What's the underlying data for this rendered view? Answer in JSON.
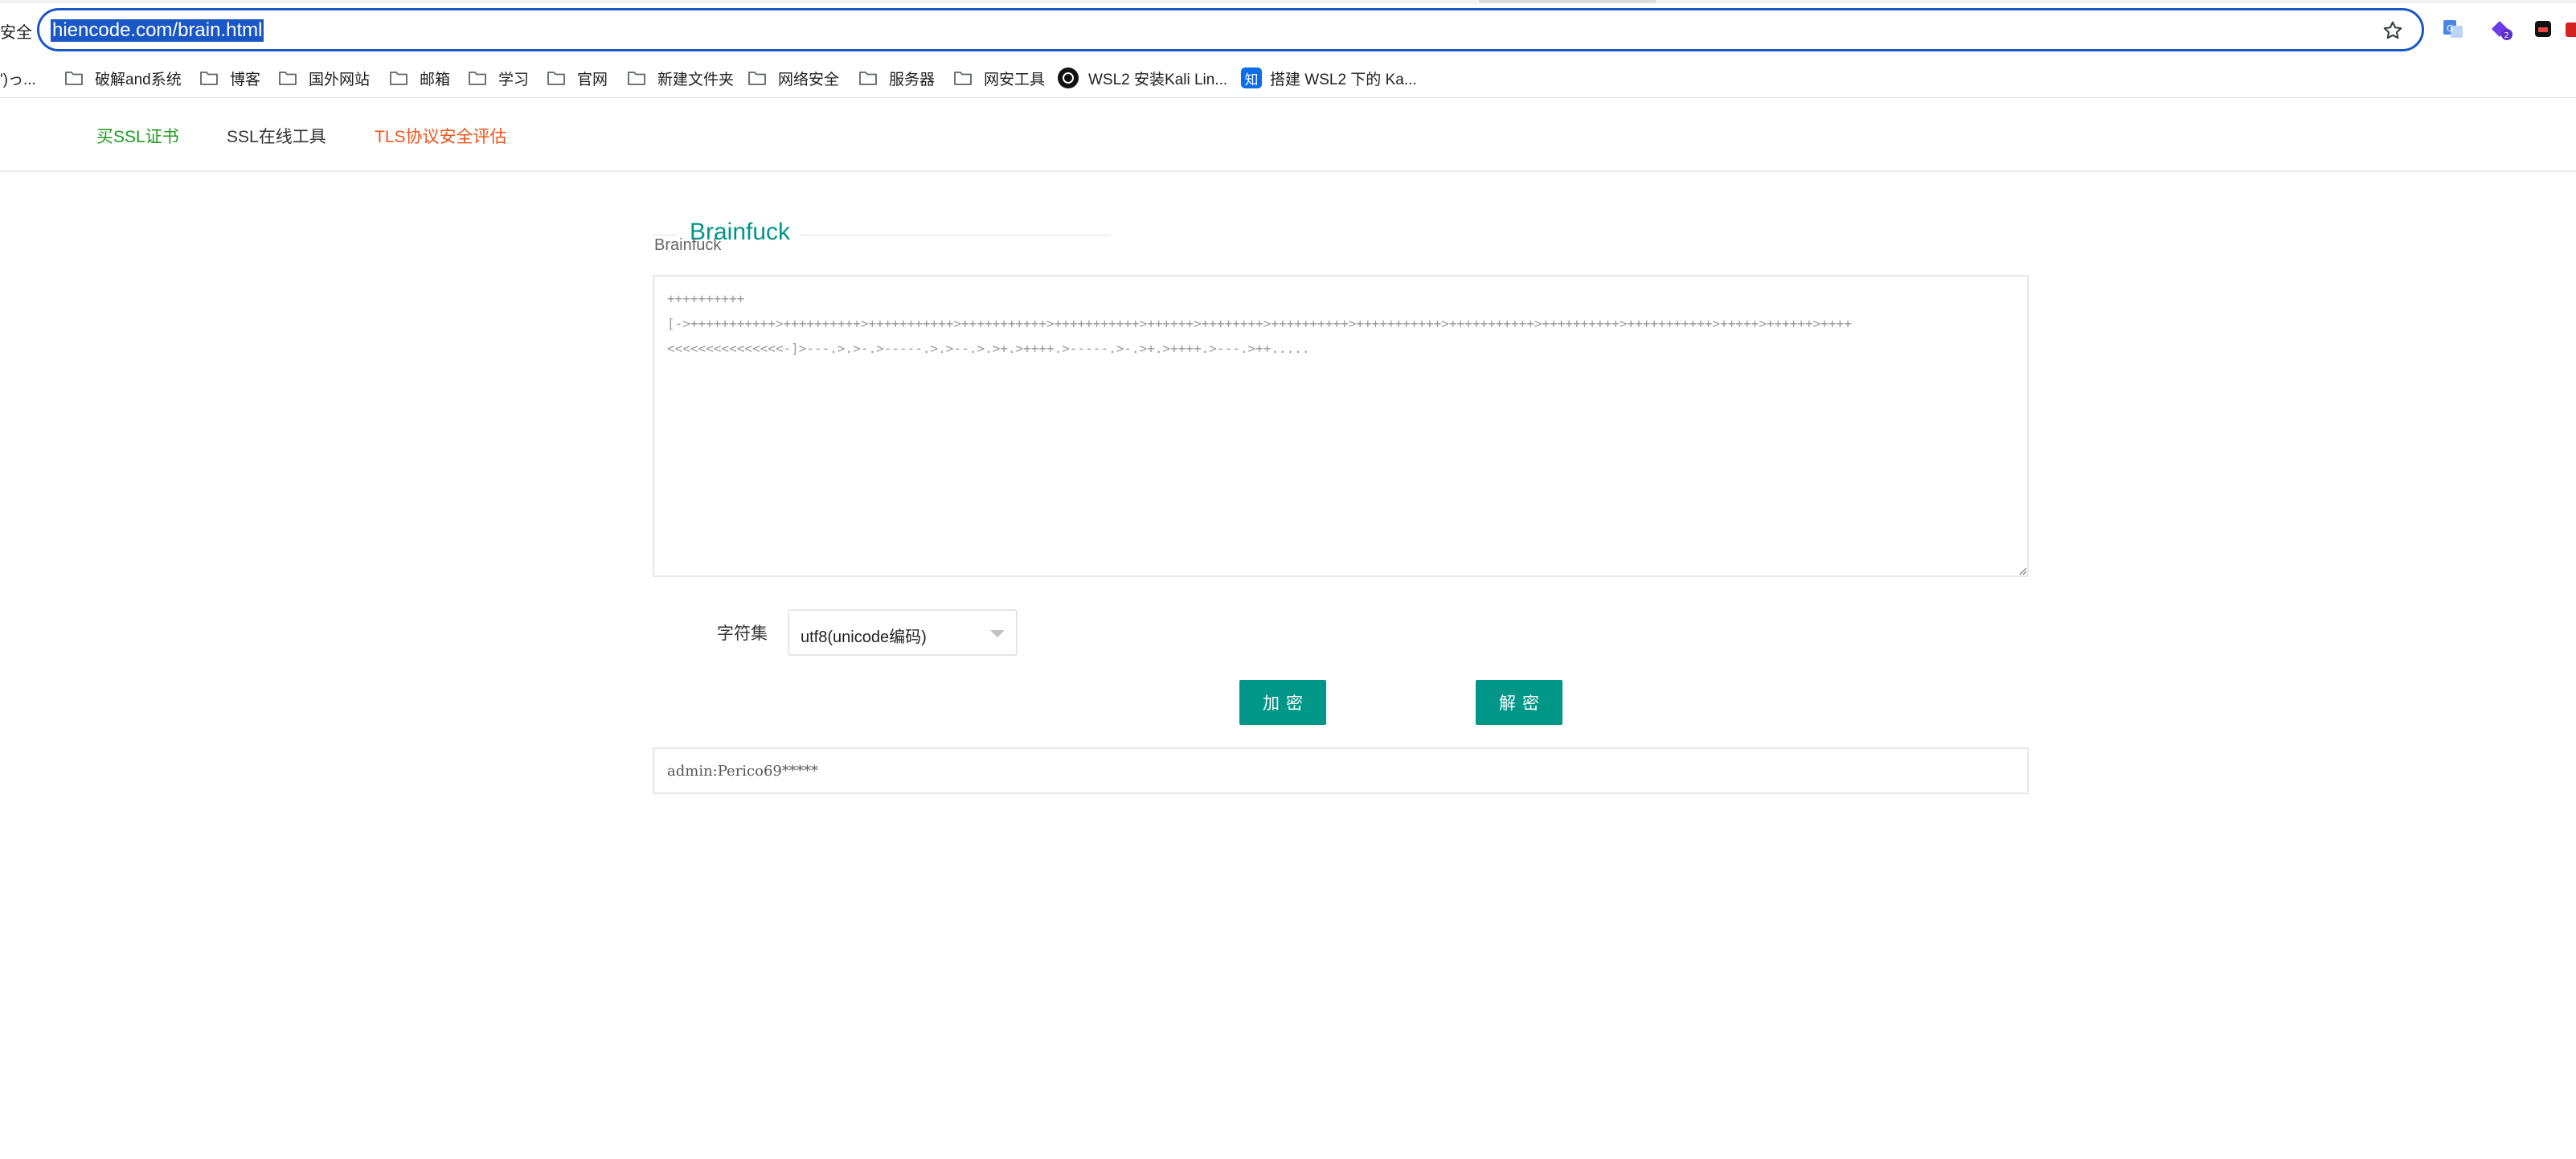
{
  "browser": {
    "security_label": "安全",
    "url": "hiencode.com/brain.html"
  },
  "bookmarks": [
    {
      "label": "')っ...",
      "icon": "none"
    },
    {
      "label": "破解and系统",
      "icon": "folder-icon"
    },
    {
      "label": "博客",
      "icon": "folder-icon"
    },
    {
      "label": "国外网站",
      "icon": "folder-icon"
    },
    {
      "label": "邮箱",
      "icon": "folder-icon"
    },
    {
      "label": "学习",
      "icon": "folder-icon"
    },
    {
      "label": "官网",
      "icon": "folder-icon"
    },
    {
      "label": "新建文件夹",
      "icon": "folder-icon"
    },
    {
      "label": "网络安全",
      "icon": "folder-icon"
    },
    {
      "label": "服务器",
      "icon": "folder-icon"
    },
    {
      "label": "网安工具",
      "icon": "folder-icon"
    },
    {
      "label": "WSL2 安装Kali Lin...",
      "icon": "site-icon"
    },
    {
      "label": "搭建 WSL2 下的 Ka...",
      "icon": "zhihu-icon",
      "icon_text": "知"
    }
  ],
  "nav": {
    "buy_ssl": "买SSL证书",
    "ssl_tools": "SSL在线工具",
    "tls_eval": "TLS协议安全评估"
  },
  "section": {
    "title": "Brainfuck",
    "field_label": "Brainfuck"
  },
  "code": "++++++++++\n[->+++++++++++>++++++++++>+++++++++++>+++++++++++>+++++++++++>++++++>++++++++>++++++++++>+++++++++++>+++++++++++>++++++++++>+++++++++++>+++++>++++++>++++\n<<<<<<<<<<<<<<<-]>---.>.>-.>-----.>.>--.>.>+.>++++.>-----.>-.>+.>++++.>---.>++.....",
  "charset": {
    "label": "字符集",
    "selected": "utf8(unicode编码)"
  },
  "buttons": {
    "encrypt": "加密",
    "decrypt": "解密"
  },
  "result": "admin:Perico69*****",
  "colors": {
    "accent": "#009688",
    "buy_link": "#1e9a1e",
    "tls_link": "#f0521a",
    "omnibox_border": "#1a57c6"
  }
}
